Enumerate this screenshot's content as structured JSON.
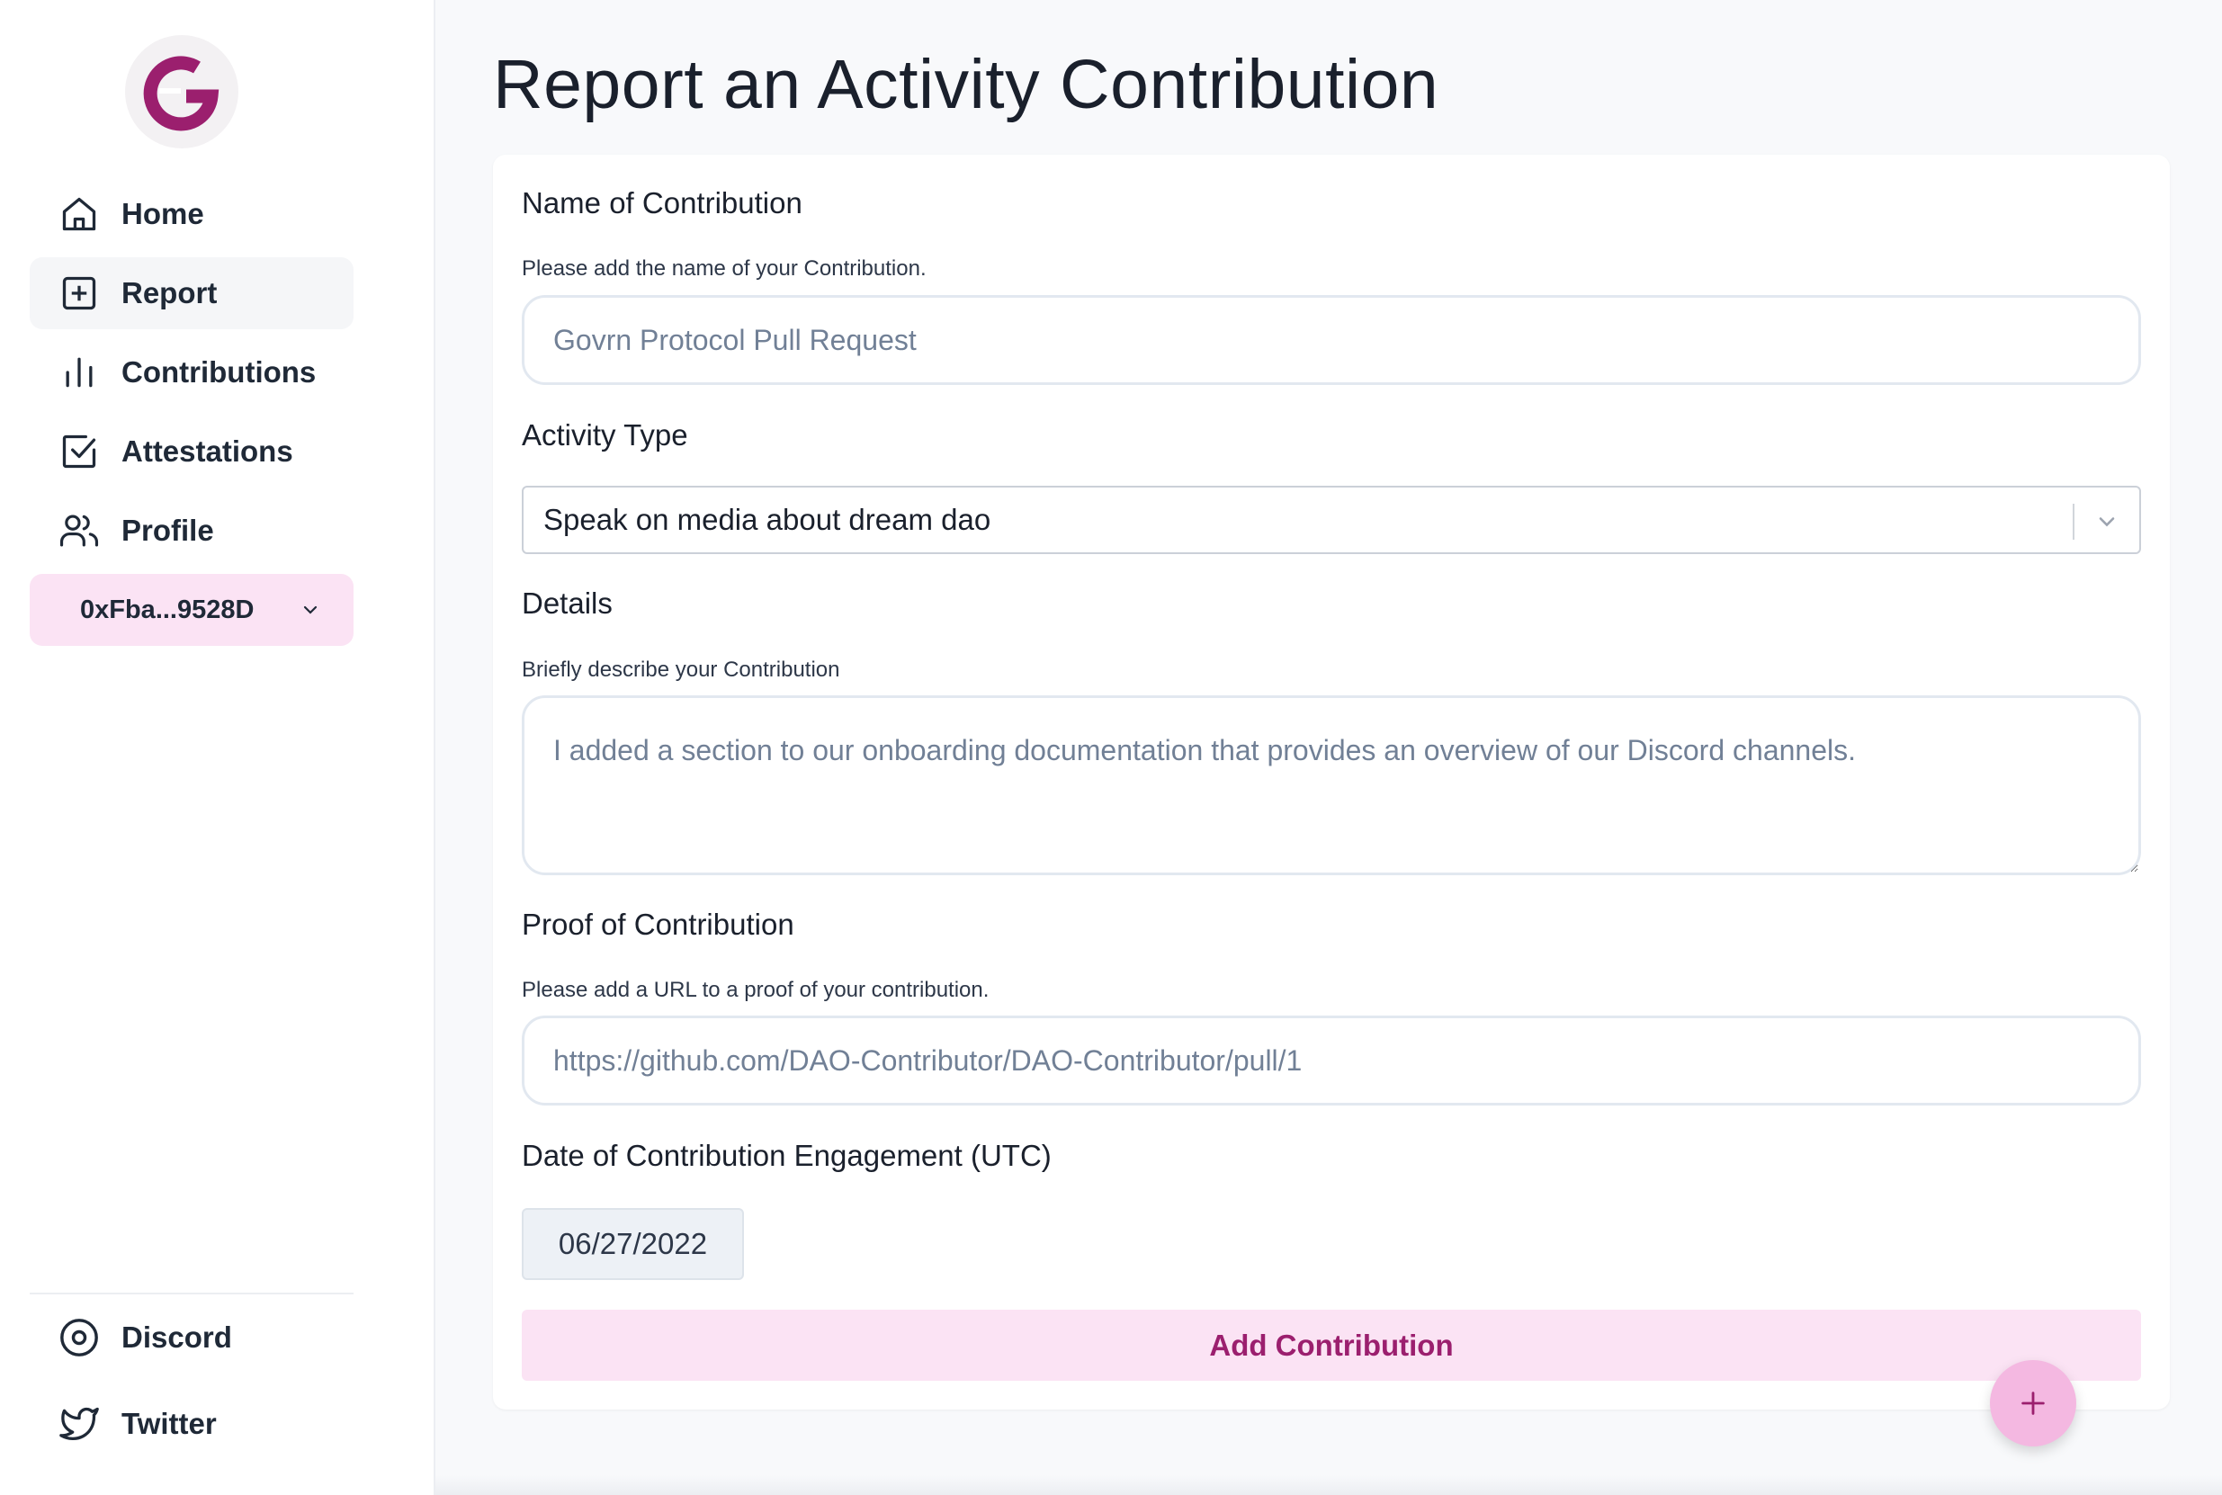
{
  "sidebar": {
    "nav": [
      {
        "label": "Home",
        "icon": "home-icon"
      },
      {
        "label": "Report",
        "icon": "plus-square-icon",
        "active": true
      },
      {
        "label": "Contributions",
        "icon": "bar-chart-icon"
      },
      {
        "label": "Attestations",
        "icon": "check-square-icon"
      },
      {
        "label": "Profile",
        "icon": "users-icon"
      }
    ],
    "wallet": "0xFba...9528D",
    "links": [
      {
        "label": "Discord",
        "icon": "discord-icon"
      },
      {
        "label": "Twitter",
        "icon": "twitter-icon"
      }
    ]
  },
  "page": {
    "title": "Report an Activity Contribution"
  },
  "form": {
    "name": {
      "label": "Name of Contribution",
      "helper": "Please add the name of your Contribution.",
      "placeholder": "Govrn Protocol Pull Request"
    },
    "activity": {
      "label": "Activity Type",
      "selected": "Speak on media about dream dao"
    },
    "details": {
      "label": "Details",
      "helper": "Briefly describe your Contribution",
      "placeholder": "I added a section to our onboarding documentation that provides an overview of our Discord channels."
    },
    "proof": {
      "label": "Proof of Contribution",
      "helper": "Please add a URL to a proof of your contribution.",
      "placeholder": "https://github.com/DAO-Contributor/DAO-Contributor/pull/1"
    },
    "date": {
      "label": "Date of Contribution Engagement (UTC)",
      "value": "06/27/2022"
    },
    "submit_label": "Add Contribution"
  },
  "colors": {
    "brand": "#9b1f6e",
    "accent_bg": "#fbe3f4",
    "fab": "#f4b8e1"
  }
}
